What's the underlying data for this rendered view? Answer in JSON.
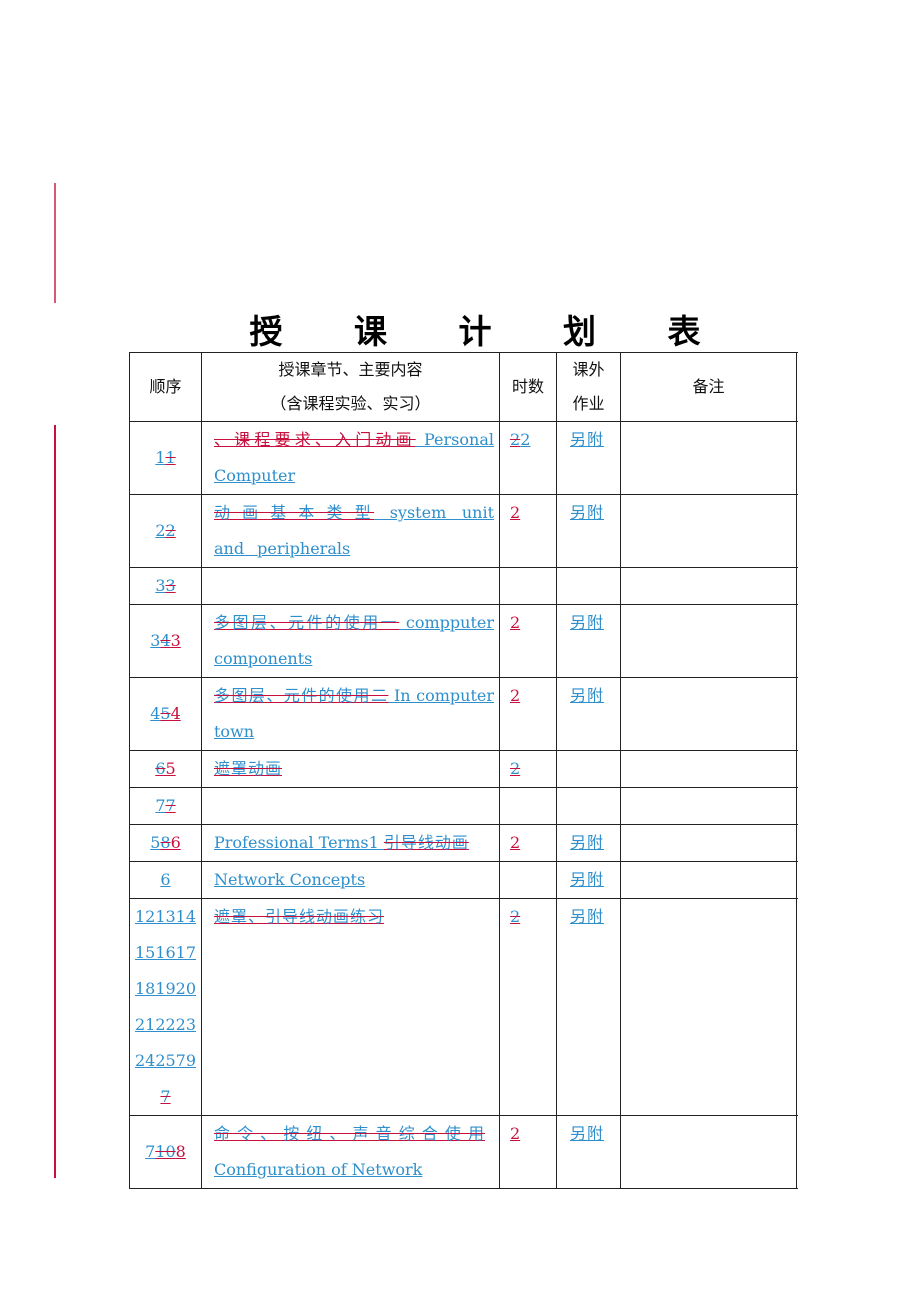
{
  "title": "授 课 计 划 表",
  "headers": {
    "seq": "顺序",
    "content_line1": "授课章节、主要内容",
    "content_line2": "（含课程实验、实习）",
    "hours": "时数",
    "homework_line1": "课外",
    "homework_line2": "作业",
    "remarks": "备注"
  },
  "rows": [
    {
      "seq_ins": "1",
      "seq_del": "1",
      "del": "、课程要求、入门动画",
      "ins": " Personal Computer",
      "hours_del": "2",
      "hours_ins": "2",
      "homework": "另附"
    },
    {
      "seq_ins": "2",
      "seq_del": "2",
      "del": "动 画 基 本 类 型",
      "ins": " system unit and peripherals",
      "hours": "2",
      "homework": "另附"
    },
    {
      "seq_ins": "3",
      "seq_del": "3"
    },
    {
      "seq_ins": "3",
      "seq_del": "4",
      "seq_new": "3",
      "del": "多图层、元件的使用一",
      "ins": " compputer components",
      "hours": "2",
      "homework": "另附"
    },
    {
      "seq_ins": "4",
      "seq_del": "5",
      "seq_new": "4",
      "del": "多图层、元件的使用二",
      "ins": " In computer town",
      "hours": "2",
      "homework": "另附"
    },
    {
      "seq_del": "6",
      "seq_new": "5",
      "del": "遮罩动画",
      "hours_del": "2"
    },
    {
      "seq_ins": "7",
      "seq_del": "7"
    },
    {
      "seq_ins": "5",
      "seq_del": "8",
      "seq_new": "6",
      "ins": "Professional Terms1 ",
      "del": "引导线动画",
      "hours": "2",
      "homework": "另附"
    },
    {
      "seq_ins": "6",
      "ins": "Network Concepts",
      "homework": "另附"
    },
    {
      "seq_lines": [
        "121314",
        "151617",
        "181920",
        "212223",
        "242579"
      ],
      "seq_last_del": "7",
      "del": "遮罩、引导线动画练习",
      "hours_del": "2",
      "homework": "另附"
    },
    {
      "seq_ins": "7",
      "seq_del": "10",
      "seq_new": "8",
      "del": "命 令 、 按 纽 、 声 音 综 合 使 用",
      "ins": "Configuration of Network",
      "hours": "2",
      "homework": "另附"
    }
  ],
  "colors": {
    "insert": "#2e8fcc",
    "delete_mark": "#c8103e"
  }
}
